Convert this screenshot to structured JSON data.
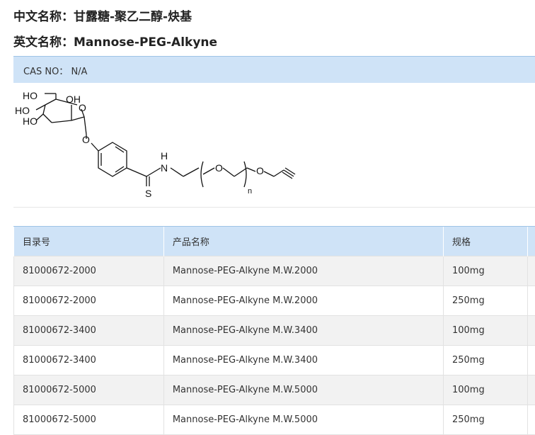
{
  "header": {
    "chinese_name_label": "中文名称：",
    "chinese_name": "甘露糖-聚乙二醇-炔基",
    "english_name_label": "英文名称：",
    "english_name": "Mannose-PEG-Alkyne"
  },
  "cas": {
    "label": "CAS NO：",
    "value": "N/A"
  },
  "structure": {
    "atoms": [
      "HO",
      "OH",
      "HO",
      "O",
      "HO",
      "O",
      "H",
      "N",
      "S",
      "O",
      "O",
      "n"
    ]
  },
  "table": {
    "headers": [
      "目录号",
      "产品名称",
      "规格"
    ],
    "rows": [
      [
        "81000672-2000",
        "Mannose-PEG-Alkyne M.W.2000",
        "100mg"
      ],
      [
        "81000672-2000",
        "Mannose-PEG-Alkyne M.W.2000",
        "250mg"
      ],
      [
        "81000672-3400",
        "Mannose-PEG-Alkyne M.W.3400",
        "100mg"
      ],
      [
        "81000672-3400",
        "Mannose-PEG-Alkyne M.W.3400",
        "250mg"
      ],
      [
        "81000672-5000",
        "Mannose-PEG-Alkyne M.W.5000",
        "100mg"
      ],
      [
        "81000672-5000",
        "Mannose-PEG-Alkyne M.W.5000",
        "250mg"
      ]
    ]
  }
}
